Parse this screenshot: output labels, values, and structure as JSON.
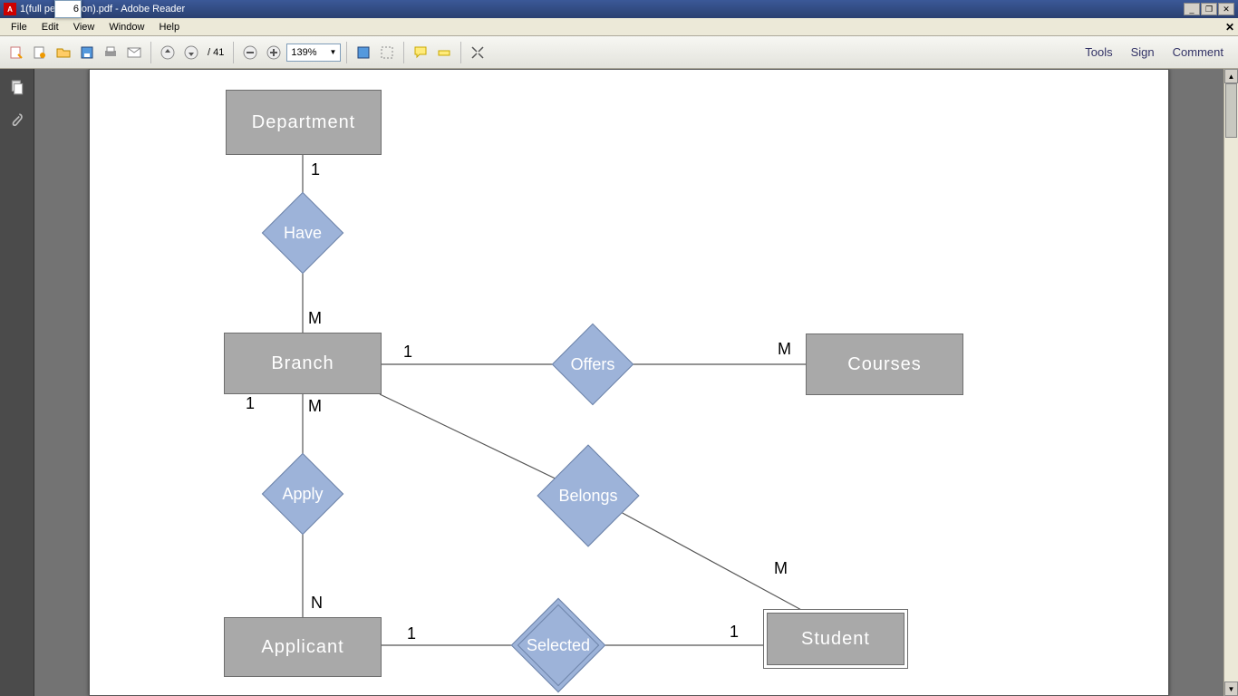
{
  "window": {
    "title": "1(full permission).pdf - Adobe Reader"
  },
  "menu": {
    "items": [
      "File",
      "Edit",
      "View",
      "Window",
      "Help"
    ]
  },
  "toolbar": {
    "page_current": "6",
    "page_total": "41",
    "zoom": "139%",
    "right": {
      "tools": "Tools",
      "sign": "Sign",
      "comment": "Comment"
    }
  },
  "diagram": {
    "entities": {
      "department": "Department",
      "branch": "Branch",
      "courses": "Courses",
      "applicant": "Applicant",
      "student": "Student"
    },
    "relationships": {
      "have": "Have",
      "offers": "Offers",
      "apply": "Apply",
      "belongs": "Belongs",
      "selected": "Selected"
    },
    "cardinalities": {
      "dept_have": "1",
      "have_branch": "M",
      "branch_offers": "1",
      "offers_courses": "M",
      "branch_apply": "M",
      "apply_applicant": "N",
      "branch_belongs": "1",
      "belongs_student": "M",
      "applicant_selected": "1",
      "selected_student": "1"
    }
  }
}
